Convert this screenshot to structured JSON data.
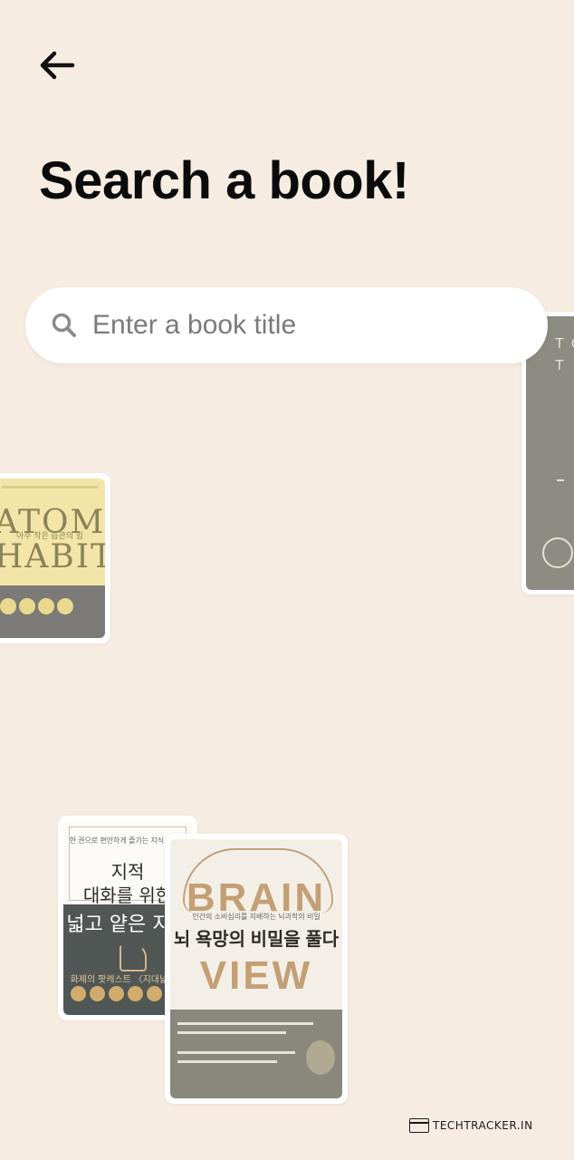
{
  "header": {
    "back_icon": "arrow-left-icon",
    "title": "Search a book!"
  },
  "search": {
    "placeholder": "Enter a book title",
    "icon": "search-icon"
  },
  "books": [
    {
      "name": "atomic-habits",
      "cover_lines": [
        "ATOMIC",
        "HABITS"
      ],
      "subtitle": "아주 작은 습관의 힘"
    },
    {
      "name": "right-book",
      "cover_lines": [
        "T O",
        "T"
      ]
    },
    {
      "name": "korean-knowledge",
      "small": "한 권으로 편안하게 즐기는 지식 여행서",
      "cover_lines": [
        "지적",
        "대화를 위한",
        "넓고 얕은 지식"
      ],
      "tagline": "화제의 팟캐스트 〈지대넓얕〉"
    },
    {
      "name": "brain-view",
      "cover_lines": [
        "BRAIN",
        "VIEW"
      ],
      "subtitle": "인간의 소비심리를 지배하는 뇌과학의 비밀",
      "korean_title": "뇌 욕망의 비밀을 풀다"
    }
  ],
  "watermark": {
    "text": "TECHTRACKER.IN"
  }
}
